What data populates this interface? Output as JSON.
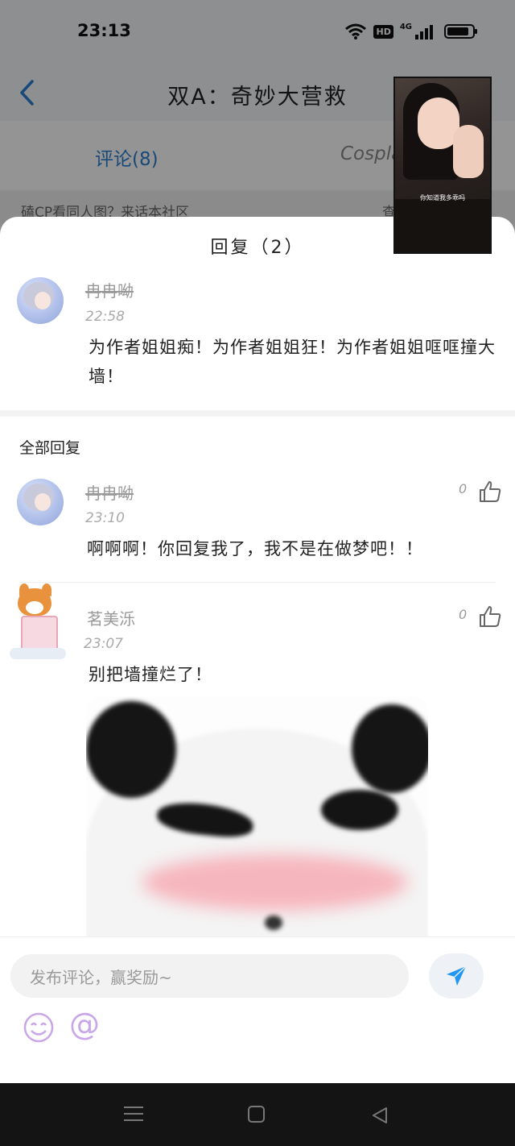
{
  "status_bar": {
    "time": "23:13",
    "hd_label": "HD",
    "network_label": "4G"
  },
  "nav": {
    "title": "双A：奇妙大营救"
  },
  "tabs": [
    {
      "label": "评论(8)"
    },
    {
      "label": "Cosplay"
    }
  ],
  "notice": {
    "text": "磕CP看同人图？来话本社区",
    "right": "查"
  },
  "pip_video": {
    "caption": "你知道我多乖吗"
  },
  "sheet": {
    "title": "回复（2）"
  },
  "main_comment": {
    "username": "冉冉呦",
    "time": "22:58",
    "text": "为作者姐姐痴！为作者姐姐狂！为作者姐姐哐哐撞大墙！"
  },
  "replies_section": {
    "title": "全部回复"
  },
  "replies": [
    {
      "username": "冉冉呦",
      "time": "23:10",
      "text": "啊啊啊！你回复我了，我不是在做梦吧！！",
      "likes": "0"
    },
    {
      "username": "茗美泺",
      "time": "23:07",
      "text": "别把墙撞烂了！",
      "likes": "0"
    }
  ],
  "input": {
    "placeholder": "发布评论，赢奖励~",
    "at_symbol": "@"
  },
  "colors": {
    "accent": "#2b7fd0",
    "send_icon": "#2196f3",
    "emoji_icon": "#c9a6e8"
  },
  "icons": [
    "wifi-icon",
    "battery-icon",
    "back-icon",
    "thumbs-up-icon",
    "send-icon",
    "emoji-icon",
    "menu-icon",
    "home-icon",
    "nav-back-icon"
  ]
}
